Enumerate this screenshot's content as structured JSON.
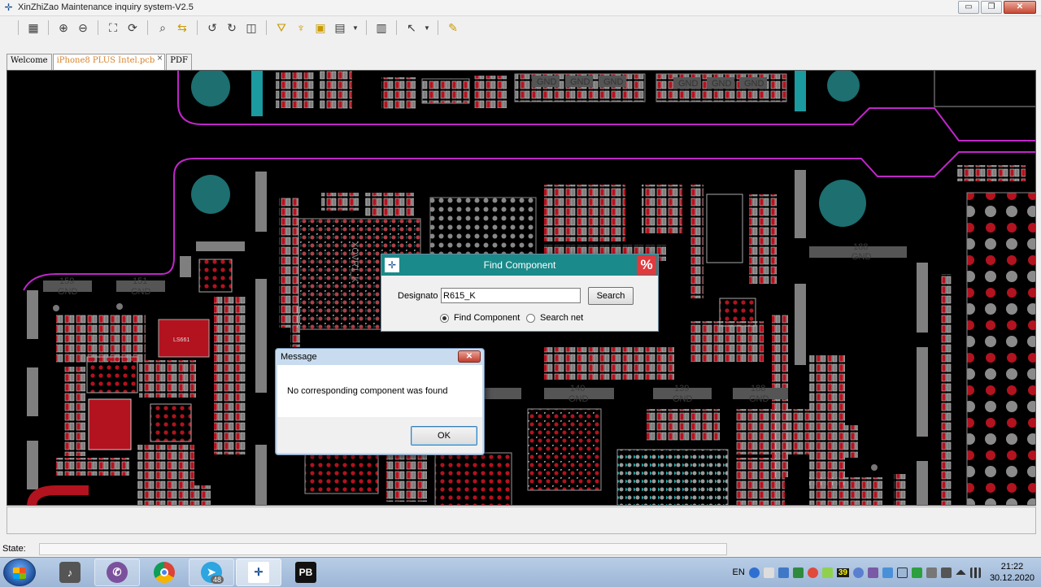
{
  "window": {
    "title": "XinZhiZao Maintenance inquiry system-V2.5",
    "buttons": {
      "minimize": "▭",
      "maximize": "❐",
      "close": "✕"
    }
  },
  "toolbar": {
    "tools": [
      "layers-icon",
      "zoom-in-icon",
      "zoom-out-icon",
      "fit-icon",
      "refresh-icon",
      "find-icon",
      "swap-icon",
      "rotate-left-icon",
      "rotate-right-icon",
      "mirror-icon",
      "highlight-icon",
      "pin-icon",
      "board-icon",
      "grid-icon",
      "panel-icon",
      "cursor-icon",
      "note-icon"
    ]
  },
  "tabs": [
    {
      "label": "Welcome",
      "active": false
    },
    {
      "label": "iPhone8 PLUS Intel.pcb",
      "active": true,
      "close": "×"
    },
    {
      "label": "PDF",
      "active": false
    }
  ],
  "pcb": {
    "labels": [
      {
        "text": "159"
      },
      {
        "text": "GND"
      },
      {
        "text": "151"
      },
      {
        "text": "GND"
      },
      {
        "text": "GND"
      },
      {
        "text": "GND"
      },
      {
        "text": "GND"
      },
      {
        "text": "GND"
      },
      {
        "text": "GND"
      },
      {
        "text": "GND"
      },
      {
        "text": "188"
      },
      {
        "text": "GND"
      },
      {
        "text": "140"
      },
      {
        "text": "GND"
      },
      {
        "text": "139"
      },
      {
        "text": "GND"
      },
      {
        "text": "188"
      },
      {
        "text": "GND"
      },
      {
        "text": "XOVR1_K"
      },
      {
        "text": "LS661"
      }
    ]
  },
  "find_dialog": {
    "title": "Find Component",
    "close_glyph": "%",
    "field_label": "Designato",
    "field_value": "R615_K",
    "search_button": "Search",
    "radio_find": "Find Component",
    "radio_net": "Search net",
    "selected": "Find Component"
  },
  "message_box": {
    "title": "Message",
    "close_glyph": "✕",
    "text": "No corresponding component was found",
    "ok_button": "OK"
  },
  "status": {
    "label": "State:",
    "value": ""
  },
  "taskbar": {
    "apps": [
      {
        "name": "mixer-app",
        "glyph": ""
      },
      {
        "name": "viber-app",
        "glyph": ""
      },
      {
        "name": "chrome-app",
        "glyph": ""
      },
      {
        "name": "telegram-app",
        "glyph": "",
        "badge": "48"
      },
      {
        "name": "xinzhizao-app",
        "glyph": ""
      },
      {
        "name": "pb-app",
        "glyph": "PB"
      }
    ],
    "tray": {
      "lang": "EN",
      "badge": "39"
    },
    "clock": {
      "time": "21:22",
      "date": "30.12.2020"
    }
  },
  "colors": {
    "canvas": "#000000",
    "pad_red": "#b3121f",
    "pad_gray": "#7f7f7f",
    "pad_teal": "#1fa6a6",
    "outline_magenta": "#c026c9",
    "dialog_title": "#1a8a8a"
  }
}
